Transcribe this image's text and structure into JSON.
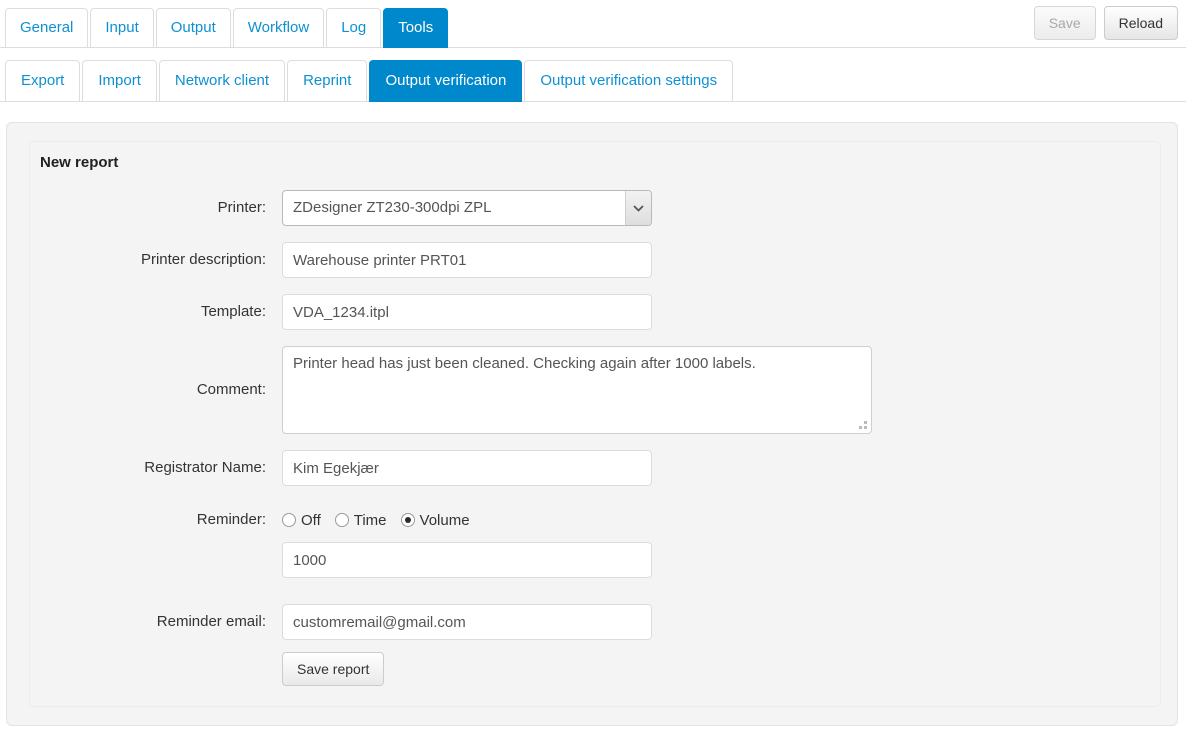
{
  "header": {
    "primary_tabs": [
      {
        "label": "General",
        "active": false
      },
      {
        "label": "Input",
        "active": false
      },
      {
        "label": "Output",
        "active": false
      },
      {
        "label": "Workflow",
        "active": false
      },
      {
        "label": "Log",
        "active": false
      },
      {
        "label": "Tools",
        "active": true
      }
    ],
    "secondary_tabs": [
      {
        "label": "Export",
        "active": false
      },
      {
        "label": "Import",
        "active": false
      },
      {
        "label": "Network client",
        "active": false
      },
      {
        "label": "Reprint",
        "active": false
      },
      {
        "label": "Output verification",
        "active": true
      },
      {
        "label": "Output verification settings",
        "active": false
      }
    ],
    "save_label": "Save",
    "reload_label": "Reload",
    "save_disabled": true
  },
  "panel": {
    "legend": "New report"
  },
  "form": {
    "printer": {
      "label": "Printer:",
      "value": "ZDesigner ZT230-300dpi ZPL",
      "options": [
        "ZDesigner ZT230-300dpi ZPL"
      ]
    },
    "printer_description": {
      "label": "Printer description:",
      "value": "Warehouse printer PRT01"
    },
    "template": {
      "label": "Template:",
      "value": "VDA_1234.itpl"
    },
    "comment": {
      "label": "Comment:",
      "value": "Printer head has just been cleaned. Checking again after 1000 labels."
    },
    "registrator_name": {
      "label": "Registrator Name:",
      "value": "Kim Egekjær"
    },
    "reminder": {
      "label": "Reminder:",
      "options": [
        {
          "label": "Off",
          "selected": false
        },
        {
          "label": "Time",
          "selected": false
        },
        {
          "label": "Volume",
          "selected": true
        }
      ],
      "value": "1000"
    },
    "reminder_email": {
      "label": "Reminder email:",
      "value": "customremail@gmail.com"
    },
    "save_report_label": "Save report"
  },
  "colors": {
    "accent": "#0088cc",
    "link": "#0e90d2",
    "panel_bg": "#f4f4f4",
    "page_bg": "#ffffff",
    "border": "#dddddd"
  },
  "icons": {
    "chevron_down": "chevron-down-icon",
    "resize_grip": "resize-grip-icon"
  }
}
